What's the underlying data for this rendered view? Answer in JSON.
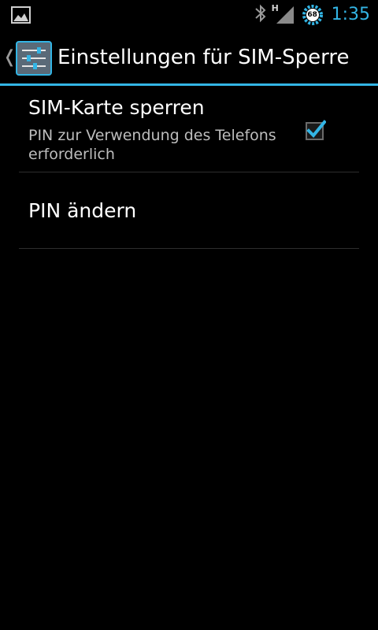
{
  "status_bar": {
    "time": "1:35",
    "battery_level": "68",
    "network_type": "H",
    "icons": [
      "image-notification-icon",
      "bluetooth-icon",
      "signal-icon",
      "battery-icon"
    ]
  },
  "action_bar": {
    "title": "Einstellungen für SIM-Sperre",
    "accent_color": "#33b5e5"
  },
  "preferences": [
    {
      "title": "SIM-Karte sperren",
      "summary": "PIN zur Verwendung des Telefons erforderlich",
      "checked": true
    },
    {
      "title": "PIN ändern"
    }
  ]
}
